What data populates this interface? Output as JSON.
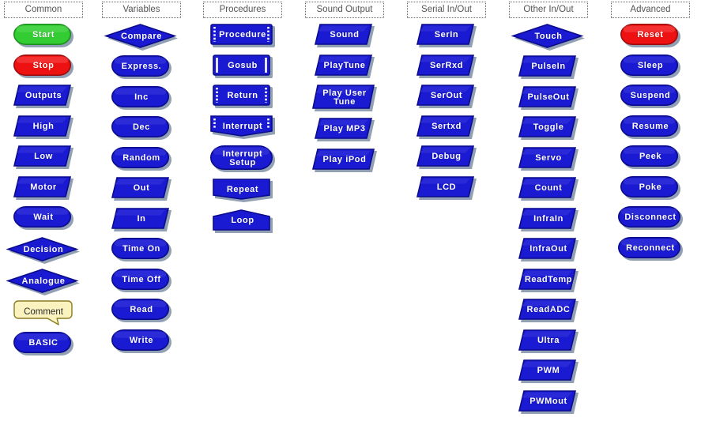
{
  "app": {
    "title": "Flowchart Block Palette",
    "background": "#ffffff"
  },
  "colors": {
    "block_blue": "#1a1ad2",
    "block_blue_dark": "#0a0a8c",
    "block_blue_light": "#4d4de6",
    "shadow": "#7f8fa6",
    "green": "#33cc33",
    "green_dark": "#1d8f1d",
    "red": "#ee1111",
    "red_dark": "#9e0b0b",
    "comment_fill": "#faf3c0",
    "comment_border": "#8a7d1e",
    "header_text": "#555555",
    "label_text": "#ffffff"
  },
  "columns": [
    {
      "id": "common",
      "header": "Common",
      "blocks": [
        {
          "label": "Start",
          "shape": "round",
          "fill": "green"
        },
        {
          "label": "Stop",
          "shape": "round",
          "fill": "red"
        },
        {
          "label": "Outputs",
          "shape": "parallelogram",
          "fill": "blue"
        },
        {
          "label": "High",
          "shape": "parallelogram",
          "fill": "blue"
        },
        {
          "label": "Low",
          "shape": "parallelogram",
          "fill": "blue"
        },
        {
          "label": "Motor",
          "shape": "parallelogram",
          "fill": "blue"
        },
        {
          "label": "Wait",
          "shape": "round",
          "fill": "blue"
        },
        {
          "label": "Decision",
          "shape": "diamond",
          "fill": "blue"
        },
        {
          "label": "Analogue",
          "shape": "diamond",
          "fill": "blue"
        },
        {
          "label": "Comment",
          "shape": "comment",
          "fill": "comment"
        },
        {
          "label": "BASIC",
          "shape": "round",
          "fill": "blue"
        }
      ]
    },
    {
      "id": "variables",
      "header": "Variables",
      "blocks": [
        {
          "label": "Compare",
          "shape": "diamond",
          "fill": "blue"
        },
        {
          "label": "Express.",
          "shape": "round",
          "fill": "blue"
        },
        {
          "label": "Inc",
          "shape": "round",
          "fill": "blue"
        },
        {
          "label": "Dec",
          "shape": "round",
          "fill": "blue"
        },
        {
          "label": "Random",
          "shape": "round",
          "fill": "blue"
        },
        {
          "label": "Out",
          "shape": "parallelogram",
          "fill": "blue"
        },
        {
          "label": "In",
          "shape": "parallelogram",
          "fill": "blue"
        },
        {
          "label": "Time On",
          "shape": "round",
          "fill": "blue"
        },
        {
          "label": "Time Off",
          "shape": "round",
          "fill": "blue"
        },
        {
          "label": "Read",
          "shape": "round",
          "fill": "blue"
        },
        {
          "label": "Write",
          "shape": "round",
          "fill": "blue"
        }
      ]
    },
    {
      "id": "procedures",
      "header": "Procedures",
      "blocks": [
        {
          "label": "Procedure",
          "shape": "dotted-sides",
          "fill": "blue"
        },
        {
          "label": "Gosub",
          "shape": "solid-sides",
          "fill": "blue"
        },
        {
          "label": "Return",
          "shape": "dotted-sides",
          "fill": "blue"
        },
        {
          "label": "Interrupt",
          "shape": "dotted-point",
          "fill": "blue"
        },
        {
          "label": "Interrupt Setup",
          "shape": "round",
          "fill": "blue",
          "lines": [
            "Interrupt",
            "Setup"
          ]
        },
        {
          "label": "Repeat",
          "shape": "pent-down",
          "fill": "blue"
        },
        {
          "label": "Loop",
          "shape": "pent-up",
          "fill": "blue"
        }
      ]
    },
    {
      "id": "sound-output",
      "header": "Sound Output",
      "blocks": [
        {
          "label": "Sound",
          "shape": "parallelogram",
          "fill": "blue"
        },
        {
          "label": "PlayTune",
          "shape": "parallelogram",
          "fill": "blue"
        },
        {
          "label": "Play User Tune",
          "shape": "parallelogram",
          "fill": "blue",
          "lines": [
            "Play User",
            "Tune"
          ]
        },
        {
          "label": "Play MP3",
          "shape": "parallelogram",
          "fill": "blue"
        },
        {
          "label": "Play iPod",
          "shape": "parallelogram",
          "fill": "blue"
        }
      ]
    },
    {
      "id": "serial-in-out",
      "header": "Serial In/Out",
      "blocks": [
        {
          "label": "SerIn",
          "shape": "parallelogram",
          "fill": "blue"
        },
        {
          "label": "SerRxd",
          "shape": "parallelogram",
          "fill": "blue"
        },
        {
          "label": "SerOut",
          "shape": "parallelogram",
          "fill": "blue"
        },
        {
          "label": "Sertxd",
          "shape": "parallelogram",
          "fill": "blue"
        },
        {
          "label": "Debug",
          "shape": "parallelogram",
          "fill": "blue"
        },
        {
          "label": "LCD",
          "shape": "parallelogram",
          "fill": "blue"
        }
      ]
    },
    {
      "id": "other-in-out",
      "header": "Other In/Out",
      "blocks": [
        {
          "label": "Touch",
          "shape": "diamond",
          "fill": "blue"
        },
        {
          "label": "PulseIn",
          "shape": "parallelogram",
          "fill": "blue"
        },
        {
          "label": "PulseOut",
          "shape": "parallelogram",
          "fill": "blue"
        },
        {
          "label": "Toggle",
          "shape": "parallelogram",
          "fill": "blue"
        },
        {
          "label": "Servo",
          "shape": "parallelogram",
          "fill": "blue"
        },
        {
          "label": "Count",
          "shape": "parallelogram",
          "fill": "blue"
        },
        {
          "label": "InfraIn",
          "shape": "parallelogram",
          "fill": "blue"
        },
        {
          "label": "InfraOut",
          "shape": "parallelogram",
          "fill": "blue"
        },
        {
          "label": "ReadTemp",
          "shape": "parallelogram",
          "fill": "blue"
        },
        {
          "label": "ReadADC",
          "shape": "parallelogram",
          "fill": "blue"
        },
        {
          "label": "Ultra",
          "shape": "parallelogram",
          "fill": "blue"
        },
        {
          "label": "PWM",
          "shape": "parallelogram",
          "fill": "blue"
        },
        {
          "label": "PWMout",
          "shape": "parallelogram",
          "fill": "blue"
        }
      ]
    },
    {
      "id": "advanced",
      "header": "Advanced",
      "blocks": [
        {
          "label": "Reset",
          "shape": "round",
          "fill": "red"
        },
        {
          "label": "Sleep",
          "shape": "round",
          "fill": "blue"
        },
        {
          "label": "Suspend",
          "shape": "round",
          "fill": "blue"
        },
        {
          "label": "Resume",
          "shape": "round",
          "fill": "blue"
        },
        {
          "label": "Peek",
          "shape": "round",
          "fill": "blue"
        },
        {
          "label": "Poke",
          "shape": "round",
          "fill": "blue"
        },
        {
          "label": "Disconnect",
          "shape": "round",
          "fill": "blue"
        },
        {
          "label": "Reconnect",
          "shape": "round",
          "fill": "blue"
        }
      ]
    }
  ]
}
